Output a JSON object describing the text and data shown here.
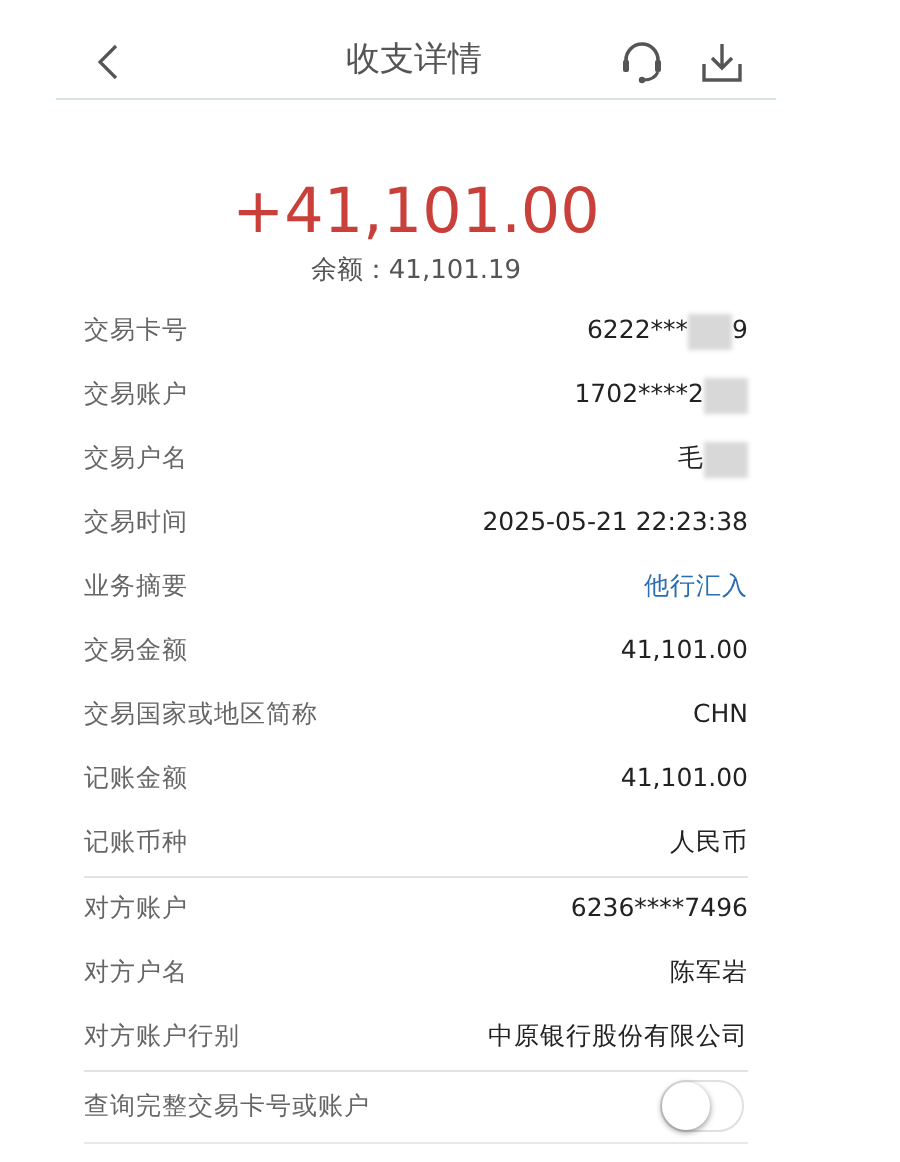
{
  "header": {
    "title": "收支详情"
  },
  "amount": "+41,101.00",
  "balance": "余额：41,101.19",
  "groups": [
    {
      "rows": [
        {
          "label": "交易卡号",
          "value": "6222***",
          "redacted": true,
          "value_tail": "9",
          "kind": "text"
        },
        {
          "label": "交易账户",
          "value": "1702****2",
          "redacted": true,
          "kind": "text"
        },
        {
          "label": "交易户名",
          "value": "毛",
          "redacted": true,
          "kind": "text"
        },
        {
          "label": "交易时间",
          "value": "2025-05-21 22:23:38",
          "redacted": false,
          "kind": "text"
        },
        {
          "label": "业务摘要",
          "value": "他行汇入",
          "redacted": false,
          "kind": "link"
        },
        {
          "label": "交易金额",
          "value": "41,101.00",
          "redacted": false,
          "kind": "text"
        },
        {
          "label": "交易国家或地区简称",
          "value": "CHN",
          "redacted": false,
          "kind": "text"
        },
        {
          "label": "记账金额",
          "value": "41,101.00",
          "redacted": false,
          "kind": "text"
        },
        {
          "label": "记账币种",
          "value": "人民币",
          "redacted": false,
          "kind": "text"
        }
      ]
    },
    {
      "rows": [
        {
          "label": "对方账户",
          "value": "6236****7496",
          "redacted": false,
          "kind": "text"
        },
        {
          "label": "对方户名",
          "value": "陈军岩",
          "redacted": false,
          "kind": "text"
        },
        {
          "label": "对方账户行别",
          "value": "中原银行股份有限公司",
          "redacted": false,
          "kind": "text"
        }
      ]
    }
  ],
  "toggle": {
    "label": "查询完整交易卡号或账户",
    "on": false
  }
}
